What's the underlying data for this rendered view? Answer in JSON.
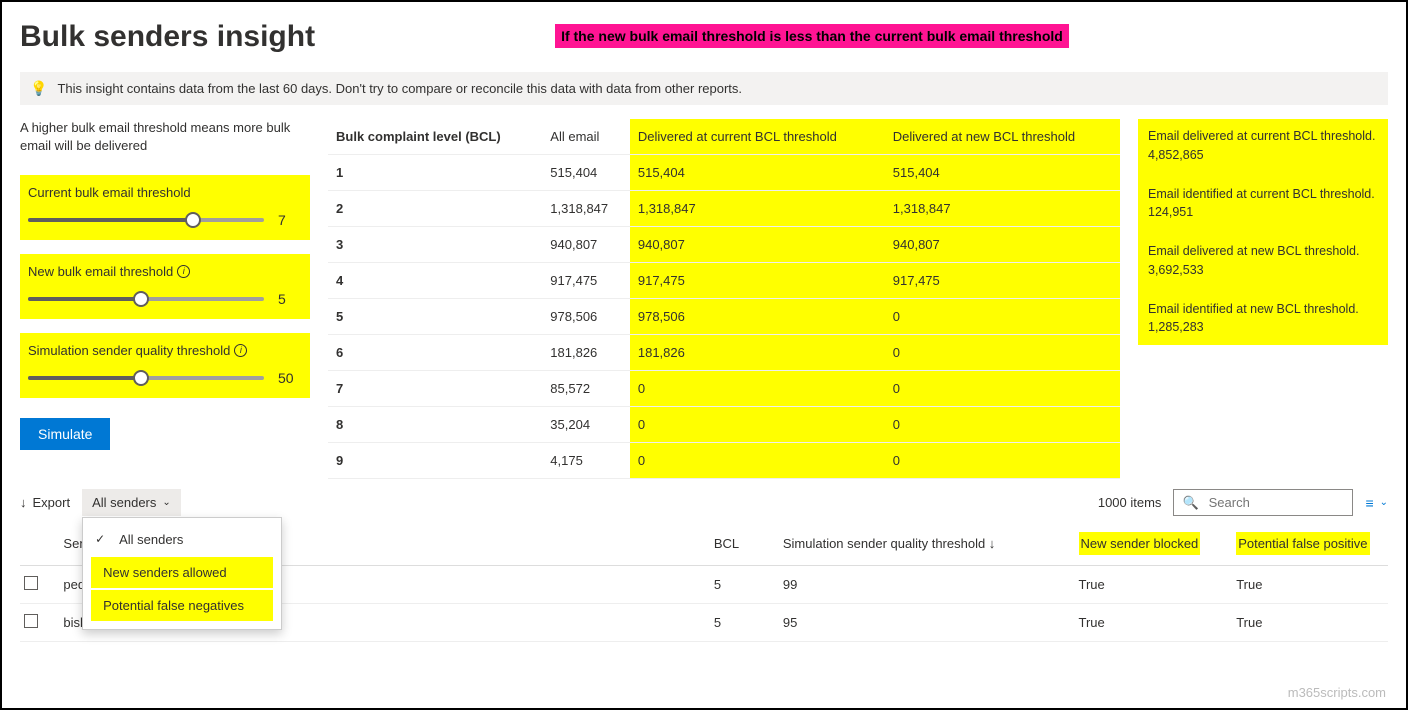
{
  "header": {
    "title": "Bulk senders insight",
    "banner": "If the new bulk email threshold is less than the current bulk email threshold"
  },
  "infoBar": "This insight contains data from the last 60 days. Don't try to compare or reconcile this data with data from other reports.",
  "leftPanel": {
    "description": "A higher bulk email threshold means more bulk email will be delivered",
    "sliders": [
      {
        "label": "Current bulk email threshold",
        "info": false,
        "value": "7",
        "pct": 70
      },
      {
        "label": "New bulk email threshold",
        "info": true,
        "value": "5",
        "pct": 48
      },
      {
        "label": "Simulation sender quality threshold",
        "info": true,
        "value": "50",
        "pct": 48
      }
    ],
    "simulateLabel": "Simulate"
  },
  "bclTable": {
    "headers": [
      "Bulk complaint level (BCL)",
      "All email",
      "Delivered at current BCL threshold",
      "Delivered at new BCL threshold"
    ],
    "rows": [
      [
        "1",
        "515,404",
        "515,404",
        "515,404"
      ],
      [
        "2",
        "1,318,847",
        "1,318,847",
        "1,318,847"
      ],
      [
        "3",
        "940,807",
        "940,807",
        "940,807"
      ],
      [
        "4",
        "917,475",
        "917,475",
        "917,475"
      ],
      [
        "5",
        "978,506",
        "978,506",
        "0"
      ],
      [
        "6",
        "181,826",
        "181,826",
        "0"
      ],
      [
        "7",
        "85,572",
        "0",
        "0"
      ],
      [
        "8",
        "35,204",
        "0",
        "0"
      ],
      [
        "9",
        "4,175",
        "0",
        "0"
      ]
    ]
  },
  "summary": [
    {
      "label": "Email delivered at current BCL threshold.",
      "value": "4,852,865"
    },
    {
      "label": "Email identified at current BCL threshold.",
      "value": "124,951"
    },
    {
      "label": "Email delivered at new BCL threshold.",
      "value": "3,692,533"
    },
    {
      "label": "Email identified at new BCL threshold.",
      "value": "1,285,283"
    }
  ],
  "toolbar": {
    "exportLabel": "Export",
    "filterSelected": "All senders",
    "filterOptions": [
      "All senders",
      "New senders allowed",
      "Potential false negatives"
    ],
    "itemCount": "1000 items",
    "searchPlaceholder": "Search"
  },
  "sendersTable": {
    "headers": {
      "sender": "Sender",
      "bcl": "BCL",
      "sim": "Simulation sender quality threshold ↓",
      "newBlocked": "New sender blocked",
      "falsePositive": "Potential false positive"
    },
    "rows": [
      {
        "sender": "pedr",
        "bcl": "5",
        "sim": "99",
        "blocked": "True",
        "fp": "True"
      },
      {
        "sender": "bishamon@treyresearch.com",
        "bcl": "5",
        "sim": "95",
        "blocked": "True",
        "fp": "True"
      }
    ]
  },
  "watermark": "m365scripts.com"
}
